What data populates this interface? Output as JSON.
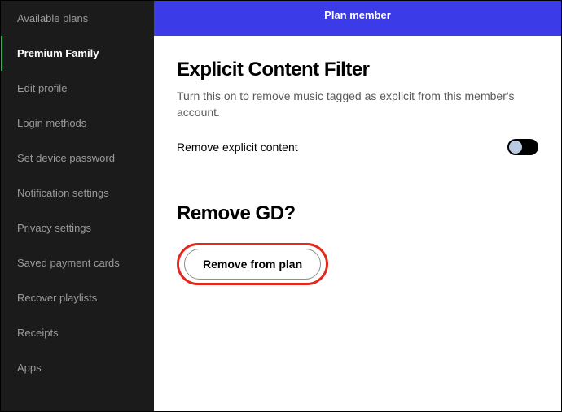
{
  "sidebar": {
    "items": [
      {
        "label": "Available plans",
        "active": false
      },
      {
        "label": "Premium Family",
        "active": true
      },
      {
        "label": "Edit profile",
        "active": false
      },
      {
        "label": "Login methods",
        "active": false
      },
      {
        "label": "Set device password",
        "active": false
      },
      {
        "label": "Notification settings",
        "active": false
      },
      {
        "label": "Privacy settings",
        "active": false
      },
      {
        "label": "Saved payment cards",
        "active": false
      },
      {
        "label": "Recover playlists",
        "active": false
      },
      {
        "label": "Receipts",
        "active": false
      },
      {
        "label": "Apps",
        "active": false
      }
    ]
  },
  "banner": {
    "title": "Plan member"
  },
  "explicit_filter": {
    "heading": "Explicit Content Filter",
    "description": "Turn this on to remove music tagged as explicit from this member's account.",
    "toggle_label": "Remove explicit content",
    "toggle_on": false
  },
  "remove_section": {
    "heading": "Remove GD?",
    "button_label": "Remove from plan",
    "highlight_color": "#e5281b"
  }
}
